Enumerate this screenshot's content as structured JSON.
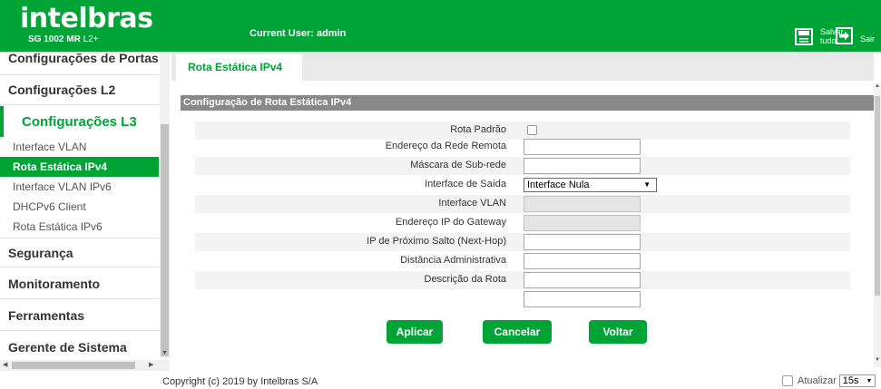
{
  "header": {
    "logo": "intelbras",
    "model_prefix": "SG 1002 MR",
    "model_suffix": " L2+",
    "current_user": "Current User: admin",
    "save_line1": "Salvar",
    "save_line2": "tudo",
    "exit_label": "Sair",
    "save_icon": "save-icon",
    "exit_icon": "exit-icon"
  },
  "sidebar": {
    "top_partial": "Configurações de Portas",
    "sections": {
      "l2": "Configurações L2",
      "l3": "Configurações L3",
      "security": "Segurança",
      "monitoring": "Monitoramento",
      "tools": "Ferramentas",
      "system": "Gerente de Sistema"
    },
    "l3_items": [
      "Interface VLAN",
      "Rota Estática IPv4",
      "Interface VLAN IPv6",
      "DHCPv6 Client",
      "Rota Estática IPv6"
    ]
  },
  "tab": {
    "label": "Rota Estática IPv4"
  },
  "panel": {
    "title": "Configuração de Rota Estática IPv4"
  },
  "form": {
    "default_route": "Rota Padrão",
    "remote_network": "Endereço da Rede Remota",
    "subnet_mask": "Máscara de Sub-rede",
    "exit_interface": "Interface de Saída",
    "exit_interface_value": "Interface Nula",
    "interface_vlan": "Interface VLAN",
    "gateway_ip": "Endereço IP do Gateway",
    "next_hop": "IP de Próximo Salto (Next-Hop)",
    "admin_distance": "Distância Administrativa",
    "route_description": "Descrição da Rota"
  },
  "buttons": {
    "apply": "Aplicar",
    "cancel": "Cancelar",
    "back": "Voltar"
  },
  "footer": {
    "copyright": "Copyright (c) 2019 by Intelbras S/A",
    "refresh_label": "Atualizar",
    "refresh_value": "15s"
  },
  "colors": {
    "brand": "#00a335",
    "panel_header": "#888888"
  }
}
